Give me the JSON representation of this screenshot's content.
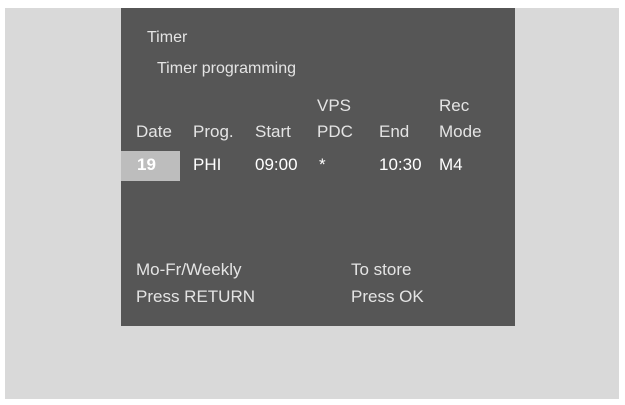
{
  "menu": {
    "title": "Timer",
    "subtitle": "Timer programming"
  },
  "columns": {
    "date": "Date",
    "prog": "Prog.",
    "start": "Start",
    "vps_top": "VPS",
    "vps_bottom": "PDC",
    "end": "End",
    "rec_top": "Rec",
    "rec_bottom": "Mode"
  },
  "entry": {
    "date": "19",
    "prog": "PHI",
    "start": "09:00",
    "vps": "*",
    "end": "10:30",
    "mode": "M4"
  },
  "footer": {
    "left_line1": "Mo-Fr/Weekly",
    "left_line2": "Press RETURN",
    "right_line1": "To store",
    "right_line2": "Press OK"
  },
  "colors": {
    "backdrop": "#d9d9d9",
    "screen": "#565656",
    "highlight": "#bdbdbd",
    "text": "#e4e4e4"
  }
}
